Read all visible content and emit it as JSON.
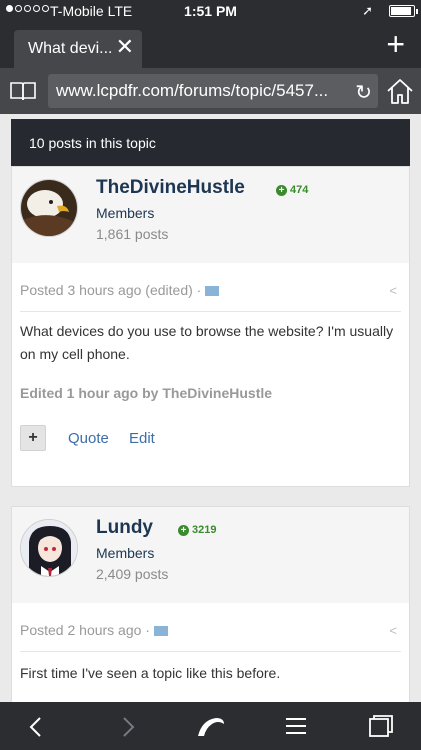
{
  "status": {
    "carrier": "T-Mobile  LTE",
    "time": "1:51 PM"
  },
  "browser": {
    "tab_title": "What devi...",
    "url": "www.lcpdfr.com/forums/topic/5457..."
  },
  "topic": {
    "post_count_label": "10 posts in this topic"
  },
  "posts": [
    {
      "author": "TheDivineHustle",
      "reputation": "474",
      "group": "Members",
      "post_count": "1,861 posts",
      "posted": "Posted 3 hours ago (edited) ·",
      "body": "What devices do you use to browse the website? I'm usually on my cell phone.",
      "edited": "Edited 1 hour ago by TheDivineHustle",
      "actions": {
        "plus": "+",
        "quote": "Quote",
        "edit": "Edit"
      }
    },
    {
      "author": "Lundy",
      "reputation": "3219",
      "group": "Members",
      "post_count": "2,409 posts",
      "posted": "Posted 2 hours ago ·",
      "body": "First time I've seen a topic like this before."
    }
  ],
  "colors": {
    "chrome_dark": "#2b2d30",
    "chrome_mid": "#45474b",
    "author_name": "#1d3652",
    "reputation": "#3b8a2e",
    "link": "#3c6ea8"
  }
}
